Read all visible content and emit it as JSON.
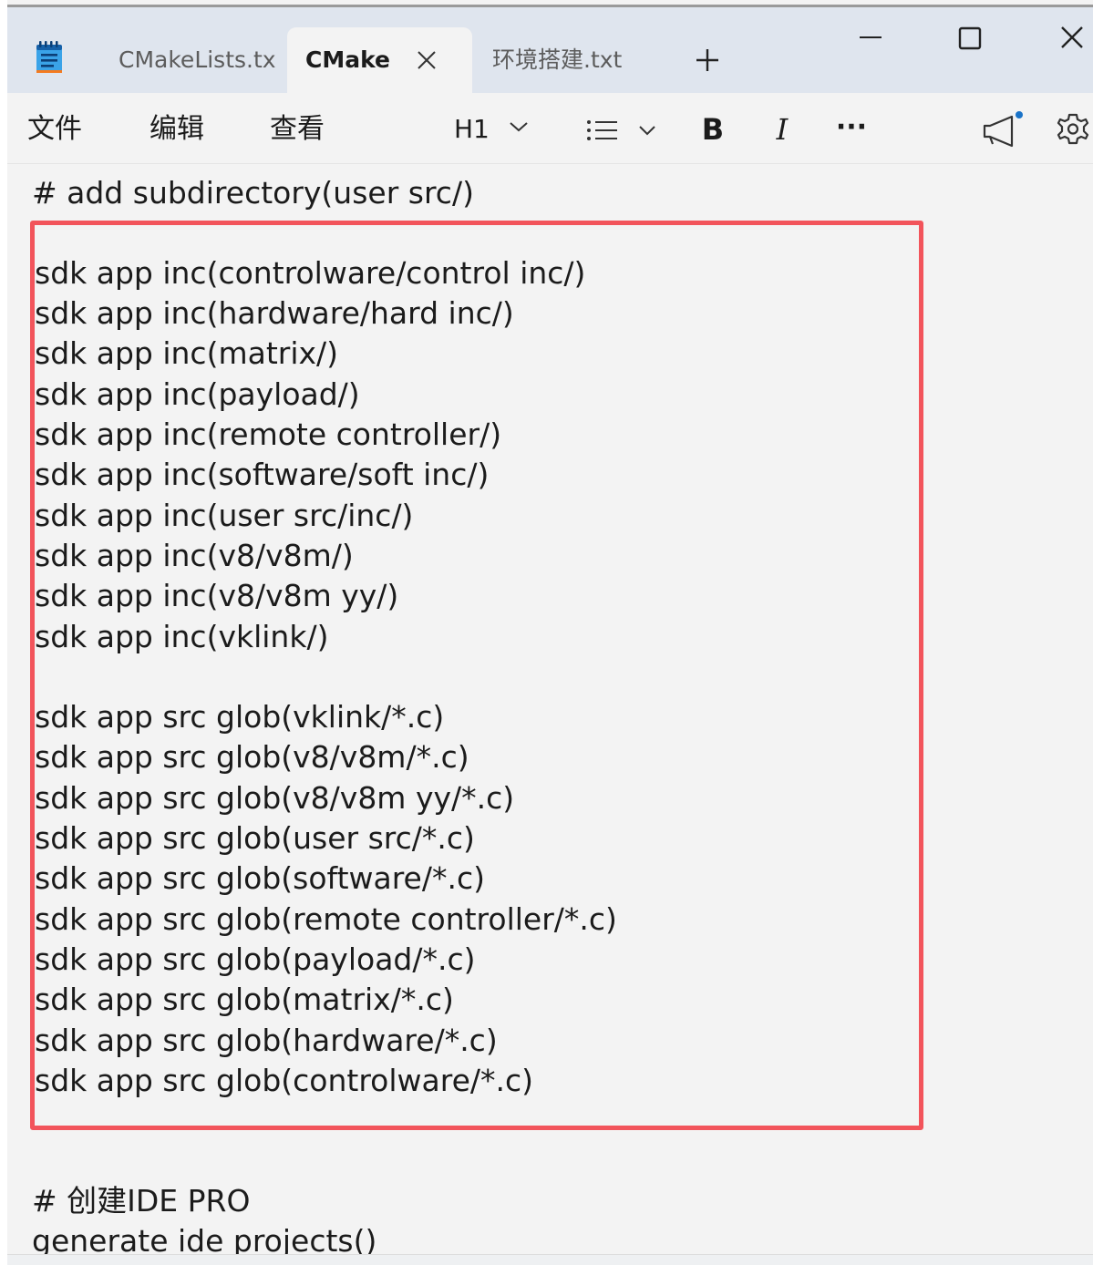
{
  "tabs": [
    {
      "label": "CMakeLists.tx",
      "active": false
    },
    {
      "label": "CMake",
      "active": true
    },
    {
      "label": "环境搭建.txt",
      "active": false
    }
  ],
  "menu": {
    "file": "文件",
    "edit": "编辑",
    "view": "查看"
  },
  "toolbar": {
    "heading": "H1",
    "bold": "B",
    "italic": "I",
    "more": "···"
  },
  "colors": {
    "highlight_border": "#f2545b",
    "titlebar_bg": "#dfe5ee",
    "editor_bg": "#f3f3f3",
    "notification_dot": "#1a73c8"
  },
  "icons": [
    "notepad-icon",
    "close-icon",
    "plus-icon",
    "minimize-icon",
    "maximize-icon",
    "chevron-down-icon",
    "bullet-list-icon",
    "megaphone-icon",
    "gear-icon"
  ],
  "editor": {
    "before_box": "# add subdirectory(user src/)",
    "inc_lines": [
      "sdk app inc(controlware/control inc/)",
      "sdk app inc(hardware/hard inc/)",
      "sdk app inc(matrix/)",
      "sdk app inc(payload/)",
      "sdk app inc(remote controller/)",
      "sdk app inc(software/soft inc/)",
      "sdk app inc(user src/inc/)",
      "sdk app inc(v8/v8m/)",
      "sdk app inc(v8/v8m yy/)",
      "sdk app inc(vklink/)"
    ],
    "src_lines": [
      "sdk app src glob(vklink/*.c)",
      "sdk app src glob(v8/v8m/*.c)",
      "sdk app src glob(v8/v8m yy/*.c)",
      "sdk app src glob(user src/*.c)",
      "sdk app src glob(software/*.c)",
      "sdk app src glob(remote controller/*.c)",
      "sdk app src glob(payload/*.c)",
      "sdk app src glob(matrix/*.c)",
      "sdk app src glob(hardware/*.c)",
      "sdk app src glob(controlware/*.c)"
    ],
    "after_box": [
      "# 创建IDE PRO",
      "generate ide projects()"
    ]
  }
}
